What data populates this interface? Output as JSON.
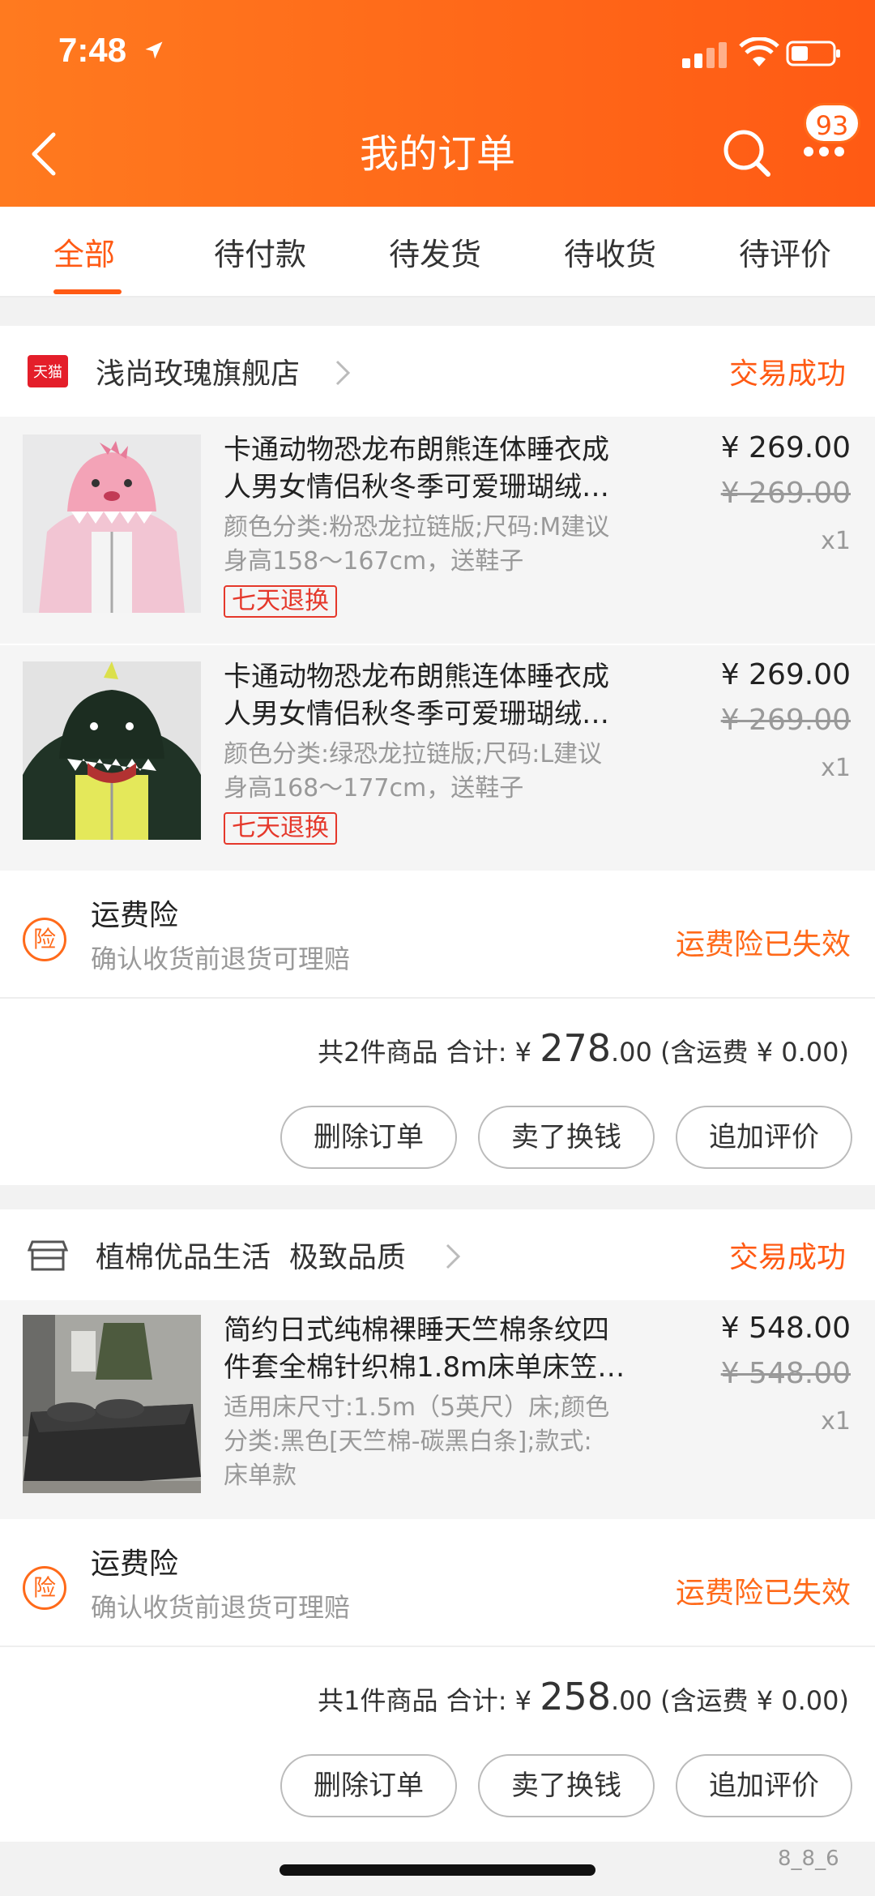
{
  "status_bar": {
    "time": "7:48"
  },
  "header": {
    "title": "我的订单",
    "badge_count": "93"
  },
  "tabs": [
    {
      "label": "全部",
      "active": true
    },
    {
      "label": "待付款"
    },
    {
      "label": "待发货"
    },
    {
      "label": "待收货"
    },
    {
      "label": "待评价"
    }
  ],
  "orders": [
    {
      "shop_icon_text": "天猫",
      "shop_name": "浅尚玫瑰旗舰店",
      "status": "交易成功",
      "items": [
        {
          "name_line1": "卡通动物恐龙布朗熊连体睡衣成",
          "name_line2": "人男女情侣秋冬季可爱珊瑚绒…",
          "spec_line1": "颜色分类:粉恐龙拉链版;尺码:M建议",
          "spec_line2": "身高158～167cm，送鞋子",
          "tag": "七天退换",
          "price": "¥ 269.00",
          "original_price": "¥ 269.00",
          "qty": "x1"
        },
        {
          "name_line1": "卡通动物恐龙布朗熊连体睡衣成",
          "name_line2": "人男女情侣秋冬季可爱珊瑚绒…",
          "spec_line1": "颜色分类:绿恐龙拉链版;尺码:L建议",
          "spec_line2": "身高168～177cm，送鞋子",
          "tag": "七天退换",
          "price": "¥ 269.00",
          "original_price": "¥ 269.00",
          "qty": "x1"
        }
      ],
      "insurance": {
        "icon": "险",
        "title": "运费险",
        "subtitle": "确认收货前退货可理赔",
        "status": "运费险已失效"
      },
      "summary": {
        "count_text": "共2件商品 合计: ¥ ",
        "total_int": "278",
        "total_dec": ".00",
        "shipping_text": " (含运费 ¥ 0.00)"
      },
      "buttons": [
        "删除订单",
        "卖了换钱",
        "追加评价"
      ]
    },
    {
      "shop_name": "植棉优品生活  极致品质",
      "status": "交易成功",
      "items": [
        {
          "name_line1": "简约日式纯棉裸睡天竺棉条纹四",
          "name_line2": "件套全棉针织棉1.8m床单床笠…",
          "spec_line1": "适用床尺寸:1.5m（5英尺）床;颜色",
          "spec_line2": "分类:黑色[天竺棉-碳黑白条];款式:",
          "spec_line3": "床单款",
          "price": "¥ 548.00",
          "original_price": "¥ 548.00",
          "qty": "x1"
        }
      ],
      "insurance": {
        "icon": "险",
        "title": "运费险",
        "subtitle": "确认收货前退货可理赔",
        "status": "运费险已失效"
      },
      "summary": {
        "count_text": "共1件商品 合计: ¥ ",
        "total_int": "258",
        "total_dec": ".00",
        "shipping_text": " (含运费 ¥ 0.00)"
      },
      "buttons": [
        "删除订单",
        "卖了换钱",
        "追加评价"
      ]
    }
  ],
  "watermark": "8_8_6"
}
